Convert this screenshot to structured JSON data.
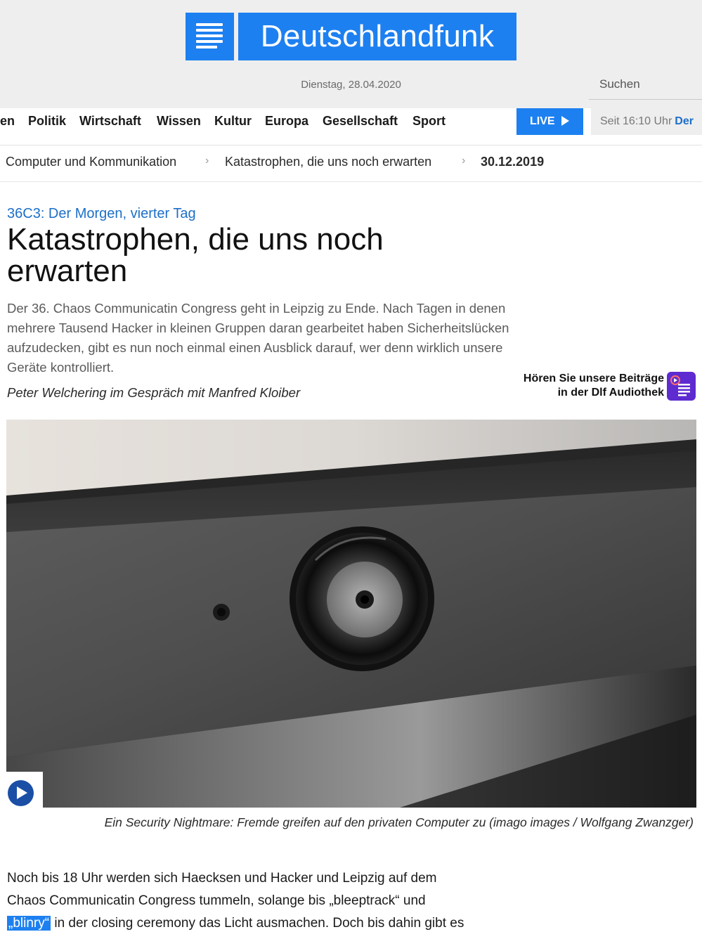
{
  "brand": {
    "name": "Deutschlandfunk",
    "color": "#1d80f0"
  },
  "header": {
    "date": "Dienstag, 28.04.2020",
    "search_label": "Suchen"
  },
  "nav": {
    "items": [
      "en",
      "Politik",
      "Wirtschaft",
      "Wissen",
      "Kultur",
      "Europa",
      "Gesellschaft",
      "Sport"
    ],
    "live_label": "LIVE",
    "now_playing_time": "Seit 16:10 Uhr",
    "now_playing_show": "Der"
  },
  "breadcrumb": {
    "items": [
      "Computer und Kommunikation",
      "Katastrophen, die uns noch erwarten",
      "30.12.2019"
    ],
    "separator": "›"
  },
  "article": {
    "kicker": "36C3: Der Morgen, vierter Tag",
    "title": "Katastrophen, die uns noch erwarten",
    "teaser": "Der 36. Chaos Communicatin Congress geht in Leipzig zu Ende. Nach Tagen in denen mehrere Tausend Hacker in kleinen Gruppen daran gearbeitet haben Sicherheitslücken aufzudecken, gibt es nun noch einmal einen Ausblick darauf, wer denn wirklich unsere Geräte kontrolliert.",
    "author_line": "Peter Welchering im Gespräch mit Manfred Kloiber",
    "audiothek_line1": "Hören Sie unsere Beiträge",
    "audiothek_line2": "in der Dlf Audiothek",
    "image_caption": "Ein Security Nightmare: Fremde greifen auf den privaten Computer zu (imago images / Wolfgang Zwanzger)",
    "body_line1": "Noch bis 18 Uhr werden sich Haecksen und Hacker und Leipzig auf dem",
    "body_line2": "Chaos Communicatin Congress tummeln, solange bis „bleeptrack“ und",
    "body_line3_highlight": "„blinry“",
    "body_line3_rest": " in der closing ceremony das Licht ausmachen. Doch bis dahin gibt es"
  },
  "icons": {
    "play": "play-icon",
    "audiothek": "audiothek-icon",
    "live_arrow": "play-arrow-icon"
  }
}
